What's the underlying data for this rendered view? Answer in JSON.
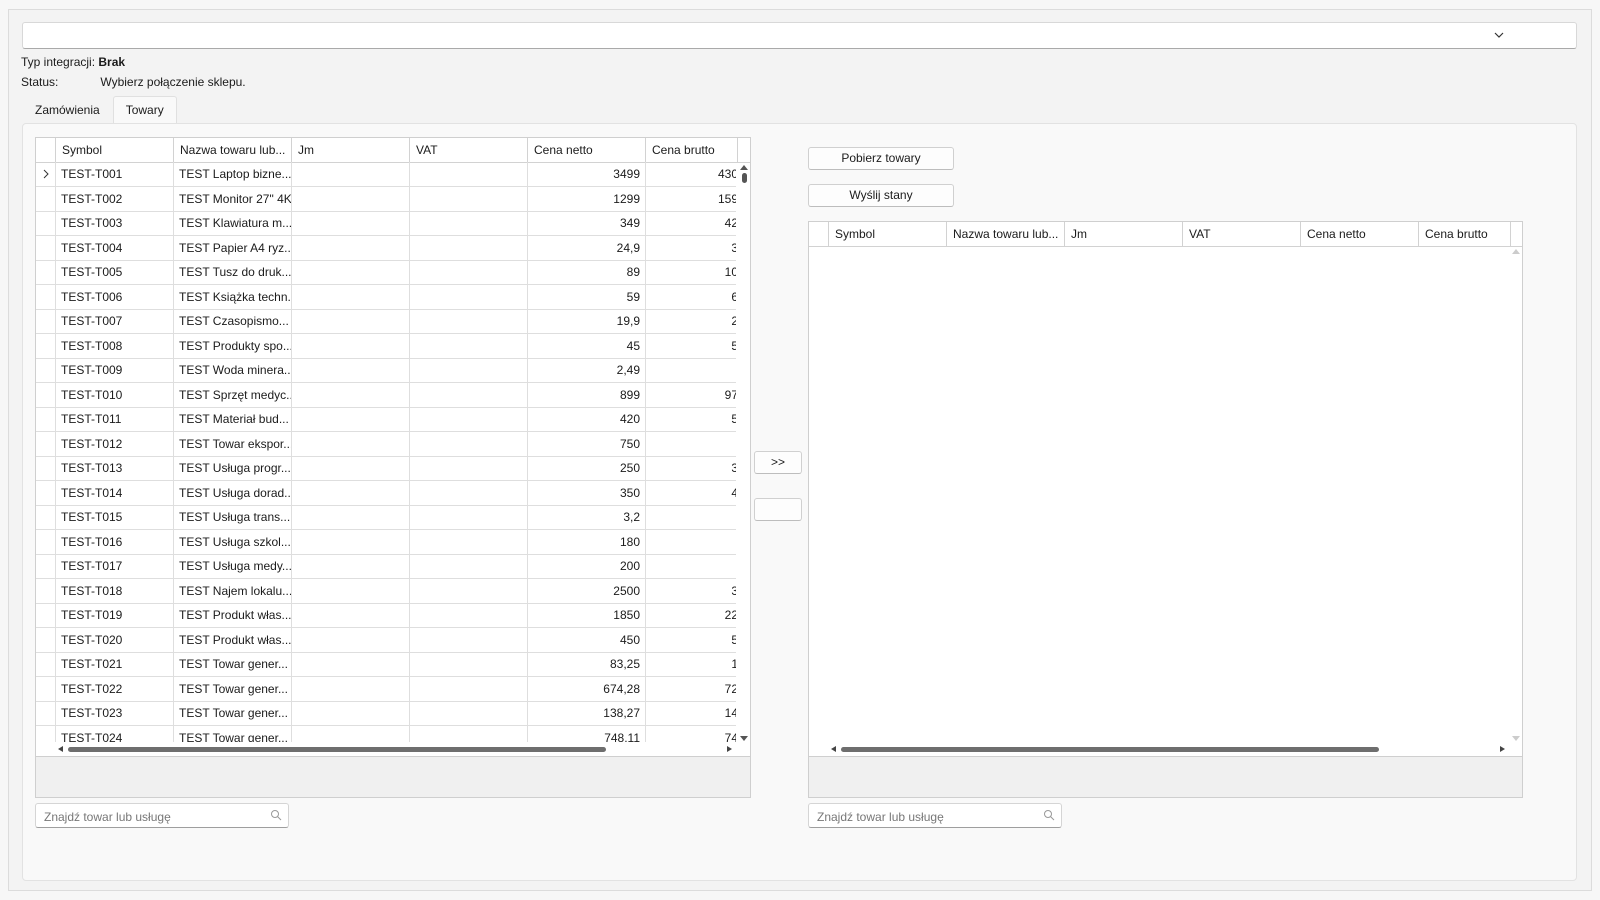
{
  "integration": {
    "type_label": "Typ integracji:",
    "type_value": "Brak",
    "status_label": "Status:",
    "status_value": "Wybierz połączenie sklepu."
  },
  "tabs": [
    {
      "label": "Zamówienia"
    },
    {
      "label": "Towary"
    }
  ],
  "columns": [
    "Symbol",
    "Nazwa towaru lub...",
    "Jm",
    "VAT",
    "Cena netto",
    "Cena brutto"
  ],
  "right_columns": [
    "Symbol",
    "Nazwa towaru lub...",
    "Jm",
    "VAT",
    "Cena netto",
    "Cena brutto"
  ],
  "rows": [
    {
      "symbol": "TEST-T001",
      "name": "TEST Laptop bizne...",
      "jm": "",
      "vat": "",
      "netto": "3499",
      "brutto": "430"
    },
    {
      "symbol": "TEST-T002",
      "name": "TEST Monitor 27\" 4K",
      "jm": "",
      "vat": "",
      "netto": "1299",
      "brutto": "159"
    },
    {
      "symbol": "TEST-T003",
      "name": "TEST Klawiatura m...",
      "jm": "",
      "vat": "",
      "netto": "349",
      "brutto": "42"
    },
    {
      "symbol": "TEST-T004",
      "name": "TEST Papier A4 ryz...",
      "jm": "",
      "vat": "",
      "netto": "24,9",
      "brutto": "3"
    },
    {
      "symbol": "TEST-T005",
      "name": "TEST Tusz do druk...",
      "jm": "",
      "vat": "",
      "netto": "89",
      "brutto": "10"
    },
    {
      "symbol": "TEST-T006",
      "name": "TEST Książka techn...",
      "jm": "",
      "vat": "",
      "netto": "59",
      "brutto": "6"
    },
    {
      "symbol": "TEST-T007",
      "name": "TEST Czasopismo...",
      "jm": "",
      "vat": "",
      "netto": "19,9",
      "brutto": "2"
    },
    {
      "symbol": "TEST-T008",
      "name": "TEST Produkty spo...",
      "jm": "",
      "vat": "",
      "netto": "45",
      "brutto": "5"
    },
    {
      "symbol": "TEST-T009",
      "name": "TEST Woda minera...",
      "jm": "",
      "vat": "",
      "netto": "2,49",
      "brutto": ""
    },
    {
      "symbol": "TEST-T010",
      "name": "TEST Sprzęt medyc...",
      "jm": "",
      "vat": "",
      "netto": "899",
      "brutto": "97"
    },
    {
      "symbol": "TEST-T011",
      "name": "TEST Materiał bud...",
      "jm": "",
      "vat": "",
      "netto": "420",
      "brutto": "5"
    },
    {
      "symbol": "TEST-T012",
      "name": "TEST Towar ekspor...",
      "jm": "",
      "vat": "",
      "netto": "750",
      "brutto": ""
    },
    {
      "symbol": "TEST-T013",
      "name": "TEST Usługa progr...",
      "jm": "",
      "vat": "",
      "netto": "250",
      "brutto": "3"
    },
    {
      "symbol": "TEST-T014",
      "name": "TEST Usługa dorad...",
      "jm": "",
      "vat": "",
      "netto": "350",
      "brutto": "4"
    },
    {
      "symbol": "TEST-T015",
      "name": "TEST Usługa trans...",
      "jm": "",
      "vat": "",
      "netto": "3,2",
      "brutto": ""
    },
    {
      "symbol": "TEST-T016",
      "name": "TEST Usługa szkol...",
      "jm": "",
      "vat": "",
      "netto": "180",
      "brutto": ""
    },
    {
      "symbol": "TEST-T017",
      "name": "TEST Usługa medy...",
      "jm": "",
      "vat": "",
      "netto": "200",
      "brutto": ""
    },
    {
      "symbol": "TEST-T018",
      "name": "TEST Najem lokalu...",
      "jm": "",
      "vat": "",
      "netto": "2500",
      "brutto": "3"
    },
    {
      "symbol": "TEST-T019",
      "name": "TEST Produkt włas...",
      "jm": "",
      "vat": "",
      "netto": "1850",
      "brutto": "22"
    },
    {
      "symbol": "TEST-T020",
      "name": "TEST Produkt włas...",
      "jm": "",
      "vat": "",
      "netto": "450",
      "brutto": "5"
    },
    {
      "symbol": "TEST-T021",
      "name": "TEST Towar gener...",
      "jm": "",
      "vat": "",
      "netto": "83,25",
      "brutto": "1"
    },
    {
      "symbol": "TEST-T022",
      "name": "TEST Towar gener...",
      "jm": "",
      "vat": "",
      "netto": "674,28",
      "brutto": "72"
    },
    {
      "symbol": "TEST-T023",
      "name": "TEST Towar gener...",
      "jm": "",
      "vat": "",
      "netto": "138,27",
      "brutto": "14"
    },
    {
      "symbol": "TEST-T024",
      "name": "TEST Towar gener...",
      "jm": "",
      "vat": "",
      "netto": "748,11",
      "brutto": "74"
    }
  ],
  "buttons": {
    "fetch": "Pobierz towary",
    "send": "Wyślij stany",
    "transfer": ">>",
    "transfer2": ""
  },
  "search": {
    "left_placeholder": "Znajdź towar lub usługę",
    "right_placeholder": "Znajdź towar lub usługę"
  }
}
